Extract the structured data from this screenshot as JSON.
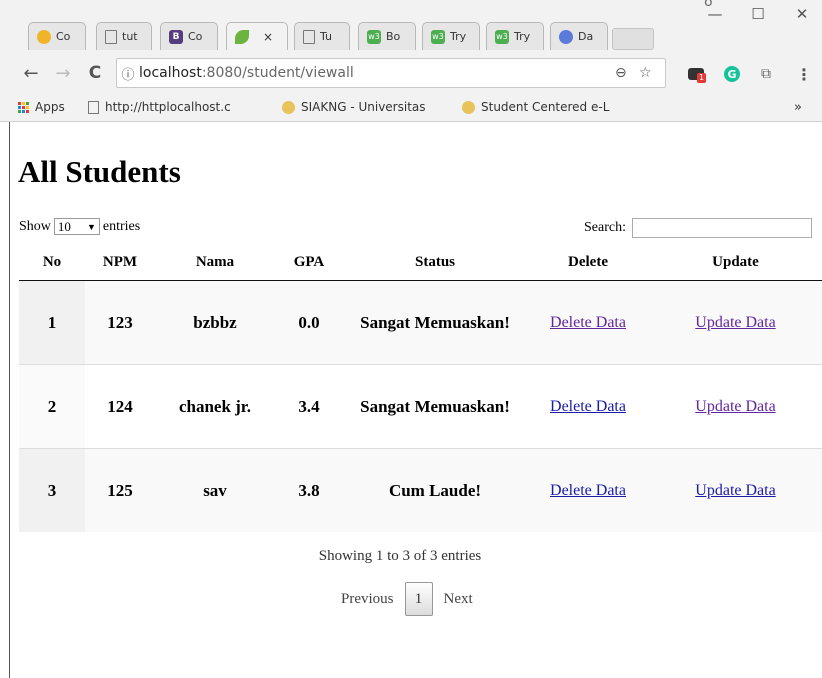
{
  "browser": {
    "tabs": [
      {
        "label": "Co",
        "icon": "sunflower-icon",
        "color": "#f0b429"
      },
      {
        "label": "tut",
        "icon": "page-icon",
        "color": "#777777"
      },
      {
        "label": "Co",
        "icon": "bootstrap-icon",
        "color": "#563d7c",
        "glyph": "B"
      },
      {
        "label": "",
        "icon": "leaf-icon",
        "color": "#6db33f",
        "active": true,
        "close": "×"
      },
      {
        "label": "Tu",
        "icon": "page-icon",
        "color": "#777777"
      },
      {
        "label": "Bo",
        "icon": "w3-icon",
        "color": "#4caf50",
        "glyph": "w3"
      },
      {
        "label": "Try",
        "icon": "w3-icon",
        "color": "#4caf50",
        "glyph": "w3"
      },
      {
        "label": "Try",
        "icon": "w3-icon",
        "color": "#4caf50",
        "glyph": "w3"
      },
      {
        "label": "Da",
        "icon": "globe-icon",
        "color": "#5c7bd9"
      }
    ],
    "window_controls": {
      "minimize": "—",
      "maximize": "☐",
      "close": "✕"
    },
    "profile_glyph": "ʊ",
    "nav": {
      "back": "←",
      "forward": "→",
      "reload": "C"
    },
    "address": {
      "info": "ⓘ",
      "host": "localhost",
      "path": ":8080/student/viewall"
    },
    "extensions": {
      "badge": "1"
    },
    "bookmarks": [
      {
        "label": "Apps",
        "icon": "apps-grid-icon"
      },
      {
        "label": "http://httplocalhost.c",
        "icon": "page-icon"
      },
      {
        "label": "SIAKNG - Universitas",
        "icon": "university-icon"
      },
      {
        "label": "Student Centered e-L",
        "icon": "university-icon"
      }
    ],
    "bookmarks_more": "»"
  },
  "page": {
    "title": "All Students",
    "show_prefix": "Show",
    "entries_value": "10",
    "show_suffix": "entries",
    "search_label": "Search:",
    "search_value": "",
    "columns": [
      "No",
      "NPM",
      "Nama",
      "GPA",
      "Status",
      "Delete",
      "Update"
    ],
    "rows": [
      {
        "no": "1",
        "npm": "123",
        "nama": "bzbbz",
        "gpa": "0.0",
        "status": "Sangat Memuaskan!",
        "delete": "Delete Data",
        "update": "Update Data"
      },
      {
        "no": "2",
        "npm": "124",
        "nama": "chanek jr.",
        "gpa": "3.4",
        "status": "Sangat Memuaskan!",
        "delete": "Delete Data",
        "update": "Update Data"
      },
      {
        "no": "3",
        "npm": "125",
        "nama": "sav",
        "gpa": "3.8",
        "status": "Cum Laude!",
        "delete": "Delete Data",
        "update": "Update Data"
      }
    ],
    "info": "Showing 1 to 3 of 3 entries",
    "pager": {
      "previous": "Previous",
      "current": "1",
      "next": "Next"
    }
  },
  "colors": {
    "link": "#1b1ba8",
    "visited_link": "#62269e"
  }
}
